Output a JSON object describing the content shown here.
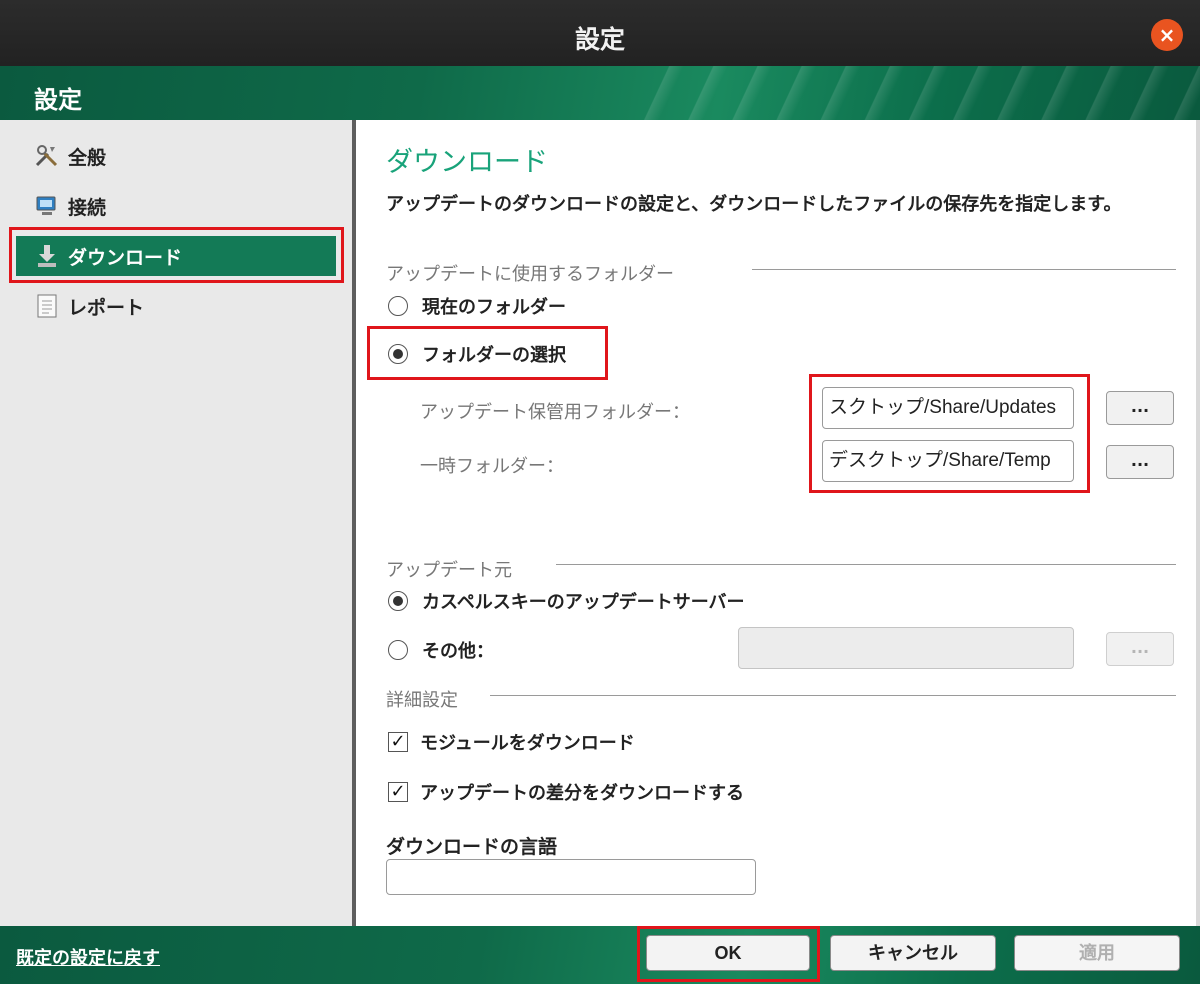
{
  "window": {
    "title": "設定",
    "close_icon": "×"
  },
  "header": {
    "title": "設定"
  },
  "sidebar": {
    "items": [
      {
        "label": "全般",
        "icon": "tools-icon"
      },
      {
        "label": "接続",
        "icon": "network-icon"
      },
      {
        "label": "ダウンロード",
        "icon": "download-icon",
        "active": true
      },
      {
        "label": "レポート",
        "icon": "report-icon"
      }
    ]
  },
  "main": {
    "title": "ダウンロード",
    "description": "アップデートのダウンロードの設定と、ダウンロードしたファイルの保存先を指定します。",
    "folder_group": {
      "label": "アップデートに使用するフォルダー",
      "option_current": "現在のフォルダー",
      "option_select": "フォルダーの選択",
      "selected": "option_select",
      "storage_label": "アップデート保管用フォルダー：",
      "storage_value": "スクトップ/Share/Updates",
      "temp_label": "一時フォルダー：",
      "temp_value": "デスクトップ/Share/Temp",
      "browse_label": "..."
    },
    "source_group": {
      "label": "アップデート元",
      "option_kaspersky": "カスペルスキーのアップデートサーバー",
      "option_other": "その他：",
      "selected": "option_kaspersky",
      "other_value": "",
      "browse_label": "..."
    },
    "advanced_group": {
      "label": "詳細設定",
      "download_modules": "モジュールをダウンロード",
      "download_modules_checked": true,
      "download_diffs": "アップデートの差分をダウンロードする",
      "download_diffs_checked": true
    },
    "language": {
      "label": "ダウンロードの言語",
      "value": ""
    }
  },
  "footer": {
    "reset_link": "既定の設定に戻す",
    "ok_label": "OK",
    "cancel_label": "キャンセル",
    "apply_label": "適用"
  },
  "colors": {
    "accent": "#137a56",
    "title_green": "#19a37a",
    "highlight": "#e0161b",
    "close": "#e95420"
  }
}
